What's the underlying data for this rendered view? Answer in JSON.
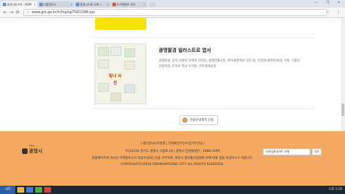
{
  "browser": {
    "tabs": [
      {
        "label": "광명시장서적 : HOM"
      },
      {
        "label": "나를정보소"
      },
      {
        "label": "광명시소회 시화 ~"
      },
      {
        "label": "가이해정보 가이"
      }
    ],
    "url": "www.gm.go.kr/lr/tng/tg/TG01188.jsp",
    "window_controls": "— ❐ ✕"
  },
  "book": {
    "title": "광명팔경 일러스트로 엽서",
    "description": "광명동굴, 오리 이원익 종택과 관감당, 광명전통시장, KTX광명역의 낙차 밤, 안양천(광명한내)의 사계, 구름산 산림욕장, 도덕산 정상 도덕정, 안터생태공원",
    "thumb_text": "빛나 사진"
  },
  "info_button": {
    "label": "관광안내책자 신청"
  },
  "footer": {
    "links": "|  개인정보보호정책  |  전자메일무단수집거부안내  |",
    "address": "우)14234 경기도 광명시 시청로 20  |  광명시 민원콜센터 : 1688-3399",
    "notice": "본홈페이지에 게시된 이메일주소가 자동수집되는것을 거부하며, 위반시 정보통신망법에 의해 처벌 됨을 유념하시기 바랍니다.",
    "copyright": "COPYRIGHT(C)2016 GWANGMYEONG CITY. ALL RIGHTS RESERVED.",
    "logo_sub": "빛나는",
    "logo_name": "광명시",
    "select_placeholder": "유관기관사이트 선택",
    "go_label": "GO"
  },
  "taskbar": {
    "start": "시작",
    "tray": "오후 5:26"
  }
}
